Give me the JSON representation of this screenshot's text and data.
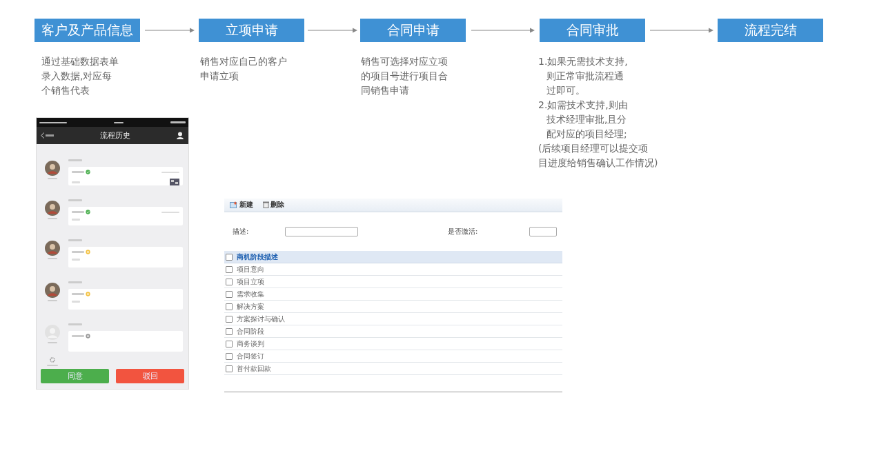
{
  "flow": {
    "steps": [
      {
        "title": "客户及产品信息",
        "lines": [
          {
            "text": "通过基础数据表单",
            "kind": "plain"
          },
          {
            "text": "录入数据,对应每",
            "kind": "plain"
          },
          {
            "text": "个销售代表",
            "kind": "plain"
          }
        ]
      },
      {
        "title": "立项申请",
        "lines": [
          {
            "text": "销售对应自己的客户",
            "kind": "plain"
          },
          {
            "text": "申请立项",
            "kind": "plain"
          }
        ]
      },
      {
        "title": "合同申请",
        "lines": [
          {
            "text": "销售可选择对应立项",
            "kind": "plain"
          },
          {
            "text": "的项目号进行项目合",
            "kind": "plain"
          },
          {
            "text": "同销售申请",
            "kind": "plain"
          }
        ]
      },
      {
        "title": "合同审批",
        "lines": [
          {
            "text": "1.如果无需技术支持,",
            "kind": "plain"
          },
          {
            "text": "则正常审批流程通",
            "kind": "continued"
          },
          {
            "text": "过即可。",
            "kind": "continued"
          },
          {
            "text": "2.如需技术支持,则由",
            "kind": "plain"
          },
          {
            "text": "技术经理审批,且分",
            "kind": "continued"
          },
          {
            "text": "配对应的项目经理;",
            "kind": "continued"
          },
          {
            "text": "(后续项目经理可以提交项",
            "kind": "plain"
          },
          {
            "text": "目进度给销售确认工作情况)",
            "kind": "plain"
          }
        ]
      },
      {
        "title": "流程完结"
      }
    ]
  },
  "phone": {
    "title": "流程历史",
    "entries": [
      {
        "kind": "approved",
        "attachment": true
      },
      {
        "kind": "approved",
        "attachment": false
      },
      {
        "kind": "pending",
        "attachment": false
      },
      {
        "kind": "pending",
        "attachment": false
      },
      {
        "kind": "waiting",
        "attachment": false
      }
    ],
    "buttons": [
      {
        "label": "同意",
        "kind": "approve"
      },
      {
        "label": "驳回",
        "kind": "reject"
      }
    ]
  },
  "table_panel": {
    "toolbar": [
      {
        "label": "新建",
        "kind": "new"
      },
      {
        "label": "删除",
        "kind": "delete"
      }
    ],
    "filters": [
      {
        "label": "描述:"
      },
      {
        "label": "是否激活:"
      }
    ],
    "header": {
      "label": "商机阶段描述",
      "checked": false
    },
    "rows": [
      {
        "label": "项目意向",
        "checked": false
      },
      {
        "label": "项目立项",
        "checked": false
      },
      {
        "label": "需求收集",
        "checked": false
      },
      {
        "label": "解决方案",
        "checked": false
      },
      {
        "label": "方案探讨与确认",
        "checked": false
      },
      {
        "label": "合同阶段",
        "checked": false
      },
      {
        "label": "商务谈判",
        "checked": false
      },
      {
        "label": "合同签订",
        "checked": false
      },
      {
        "label": "首付款回款",
        "checked": false
      }
    ]
  }
}
